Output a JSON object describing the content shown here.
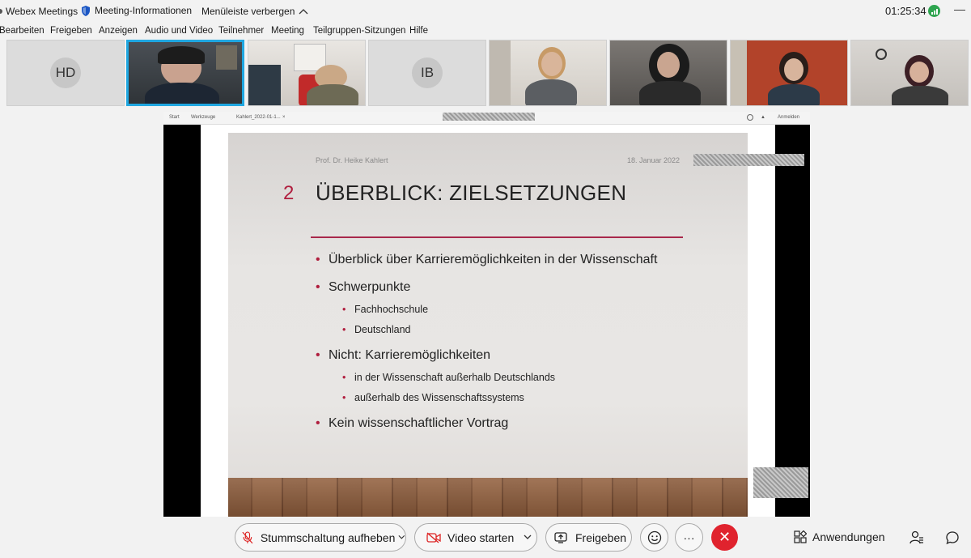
{
  "titlebar": {
    "app_name": "Webex Meetings",
    "meeting_info": "Meeting-Informationen",
    "hide_menu": "Menüleiste verbergen",
    "clock": "01:25:34"
  },
  "menu": [
    "Bearbeiten",
    "Freigeben",
    "Anzeigen",
    "Audio und Video",
    "Teilnehmer",
    "Meeting",
    "Teilgruppen-Sitzungen",
    "Hilfe"
  ],
  "participants": [
    {
      "initials": "HD",
      "video": false
    },
    {
      "initials": "",
      "video": true,
      "active": true
    },
    {
      "initials": "",
      "video": true
    },
    {
      "initials": "IB",
      "video": false
    },
    {
      "initials": "",
      "video": true
    },
    {
      "initials": "",
      "video": true
    },
    {
      "initials": "",
      "video": true
    },
    {
      "initials": "",
      "video": true
    }
  ],
  "viewer": {
    "tab_start": "Start",
    "tab_tools": "Werkzeuge",
    "doc_tab": "Kahlert_2022-01-1...",
    "sign_in": "Anmelden"
  },
  "slide": {
    "author": "Prof. Dr. Heike Kahlert",
    "date": "18. Januar 2022",
    "number": "2",
    "title": "ÜBERBLICK: ZIELSETZUNGEN",
    "bullets": [
      "Überblick über Karrieremöglichkeiten in der Wissenschaft",
      "Schwerpunkte",
      "Fachhochschule",
      "Deutschland",
      "Nicht: Karrieremöglichkeiten",
      "in der Wissenschaft außerhalb Deutschlands",
      "außerhalb des Wissenschaftssystems",
      "Kein wissenschaftlicher Vortrag"
    ]
  },
  "toolbar": {
    "unmute": "Stummschaltung aufheben",
    "start_video": "Video starten",
    "share": "Freigeben",
    "more": "···",
    "apps": "Anwendungen"
  },
  "colors": {
    "accent_active": "#1fa7e1",
    "leave_red": "#e0232e",
    "slide_accent": "#b01e3e",
    "signal_green": "#2da44e"
  }
}
